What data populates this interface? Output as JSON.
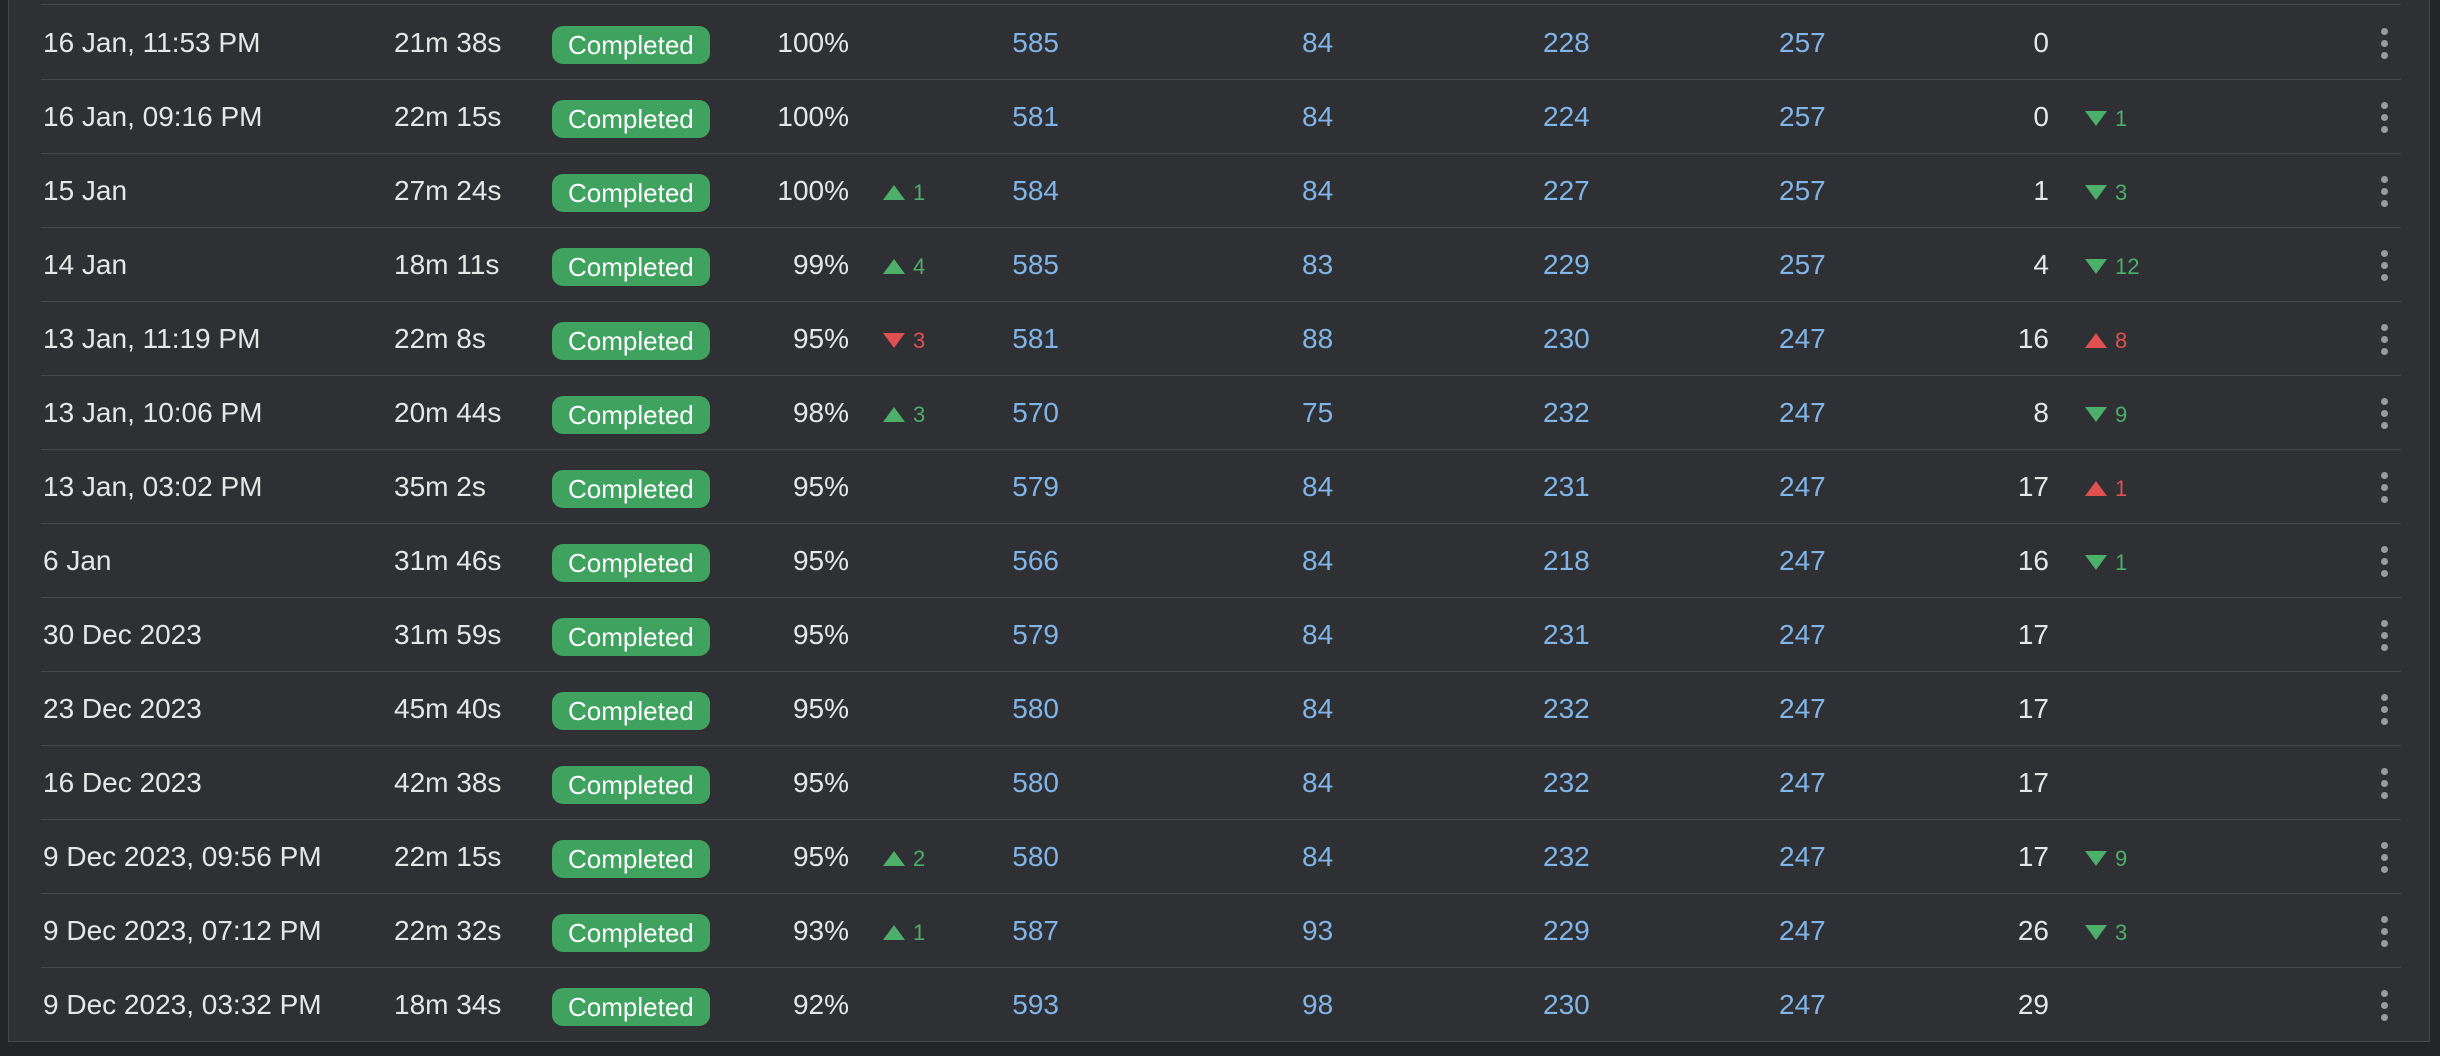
{
  "table": {
    "rows": [
      {
        "date": "16 Jan, 11:53 PM",
        "duration": "21m 38s",
        "status": "Completed",
        "pct": "100%",
        "pct_delta": null,
        "a": "585",
        "b": "84",
        "c": "228",
        "d": "257",
        "e": "0",
        "e_delta": null
      },
      {
        "date": "16 Jan, 09:16 PM",
        "duration": "22m 15s",
        "status": "Completed",
        "pct": "100%",
        "pct_delta": null,
        "a": "581",
        "b": "84",
        "c": "224",
        "d": "257",
        "e": "0",
        "e_delta": {
          "dir": "down",
          "value": "1",
          "tone": "good"
        }
      },
      {
        "date": "15 Jan",
        "duration": "27m 24s",
        "status": "Completed",
        "pct": "100%",
        "pct_delta": {
          "dir": "up",
          "value": "1",
          "tone": "good"
        },
        "a": "584",
        "b": "84",
        "c": "227",
        "d": "257",
        "e": "1",
        "e_delta": {
          "dir": "down",
          "value": "3",
          "tone": "good"
        }
      },
      {
        "date": "14 Jan",
        "duration": "18m 11s",
        "status": "Completed",
        "pct": "99%",
        "pct_delta": {
          "dir": "up",
          "value": "4",
          "tone": "good"
        },
        "a": "585",
        "b": "83",
        "c": "229",
        "d": "257",
        "e": "4",
        "e_delta": {
          "dir": "down",
          "value": "12",
          "tone": "good"
        }
      },
      {
        "date": "13 Jan, 11:19 PM",
        "duration": "22m 8s",
        "status": "Completed",
        "pct": "95%",
        "pct_delta": {
          "dir": "down",
          "value": "3",
          "tone": "bad"
        },
        "a": "581",
        "b": "88",
        "c": "230",
        "d": "247",
        "e": "16",
        "e_delta": {
          "dir": "up",
          "value": "8",
          "tone": "bad"
        }
      },
      {
        "date": "13 Jan, 10:06 PM",
        "duration": "20m 44s",
        "status": "Completed",
        "pct": "98%",
        "pct_delta": {
          "dir": "up",
          "value": "3",
          "tone": "good"
        },
        "a": "570",
        "b": "75",
        "c": "232",
        "d": "247",
        "e": "8",
        "e_delta": {
          "dir": "down",
          "value": "9",
          "tone": "good"
        }
      },
      {
        "date": "13 Jan, 03:02 PM",
        "duration": "35m 2s",
        "status": "Completed",
        "pct": "95%",
        "pct_delta": null,
        "a": "579",
        "b": "84",
        "c": "231",
        "d": "247",
        "e": "17",
        "e_delta": {
          "dir": "up",
          "value": "1",
          "tone": "bad"
        }
      },
      {
        "date": "6 Jan",
        "duration": "31m 46s",
        "status": "Completed",
        "pct": "95%",
        "pct_delta": null,
        "a": "566",
        "b": "84",
        "c": "218",
        "d": "247",
        "e": "16",
        "e_delta": {
          "dir": "down",
          "value": "1",
          "tone": "good"
        }
      },
      {
        "date": "30 Dec 2023",
        "duration": "31m 59s",
        "status": "Completed",
        "pct": "95%",
        "pct_delta": null,
        "a": "579",
        "b": "84",
        "c": "231",
        "d": "247",
        "e": "17",
        "e_delta": null
      },
      {
        "date": "23 Dec 2023",
        "duration": "45m 40s",
        "status": "Completed",
        "pct": "95%",
        "pct_delta": null,
        "a": "580",
        "b": "84",
        "c": "232",
        "d": "247",
        "e": "17",
        "e_delta": null
      },
      {
        "date": "16 Dec 2023",
        "duration": "42m 38s",
        "status": "Completed",
        "pct": "95%",
        "pct_delta": null,
        "a": "580",
        "b": "84",
        "c": "232",
        "d": "247",
        "e": "17",
        "e_delta": null
      },
      {
        "date": "9 Dec 2023, 09:56 PM",
        "duration": "22m 15s",
        "status": "Completed",
        "pct": "95%",
        "pct_delta": {
          "dir": "up",
          "value": "2",
          "tone": "good"
        },
        "a": "580",
        "b": "84",
        "c": "232",
        "d": "247",
        "e": "17",
        "e_delta": {
          "dir": "down",
          "value": "9",
          "tone": "good"
        }
      },
      {
        "date": "9 Dec 2023, 07:12 PM",
        "duration": "22m 32s",
        "status": "Completed",
        "pct": "93%",
        "pct_delta": {
          "dir": "up",
          "value": "1",
          "tone": "good"
        },
        "a": "587",
        "b": "93",
        "c": "229",
        "d": "247",
        "e": "26",
        "e_delta": {
          "dir": "down",
          "value": "3",
          "tone": "good"
        }
      },
      {
        "date": "9 Dec 2023, 03:32 PM",
        "duration": "18m 34s",
        "status": "Completed",
        "pct": "92%",
        "pct_delta": null,
        "a": "593",
        "b": "98",
        "c": "230",
        "d": "247",
        "e": "29",
        "e_delta": null
      }
    ]
  },
  "colors": {
    "background": "#242528",
    "panel": "#2f3033",
    "badge": "#3fa35f",
    "link": "#7fb5e8",
    "good": "#4caf6a",
    "bad": "#e05050"
  },
  "icons": {
    "row_menu": "more-vertical-icon",
    "delta_up": "triangle-up-icon",
    "delta_down": "triangle-down-icon"
  }
}
